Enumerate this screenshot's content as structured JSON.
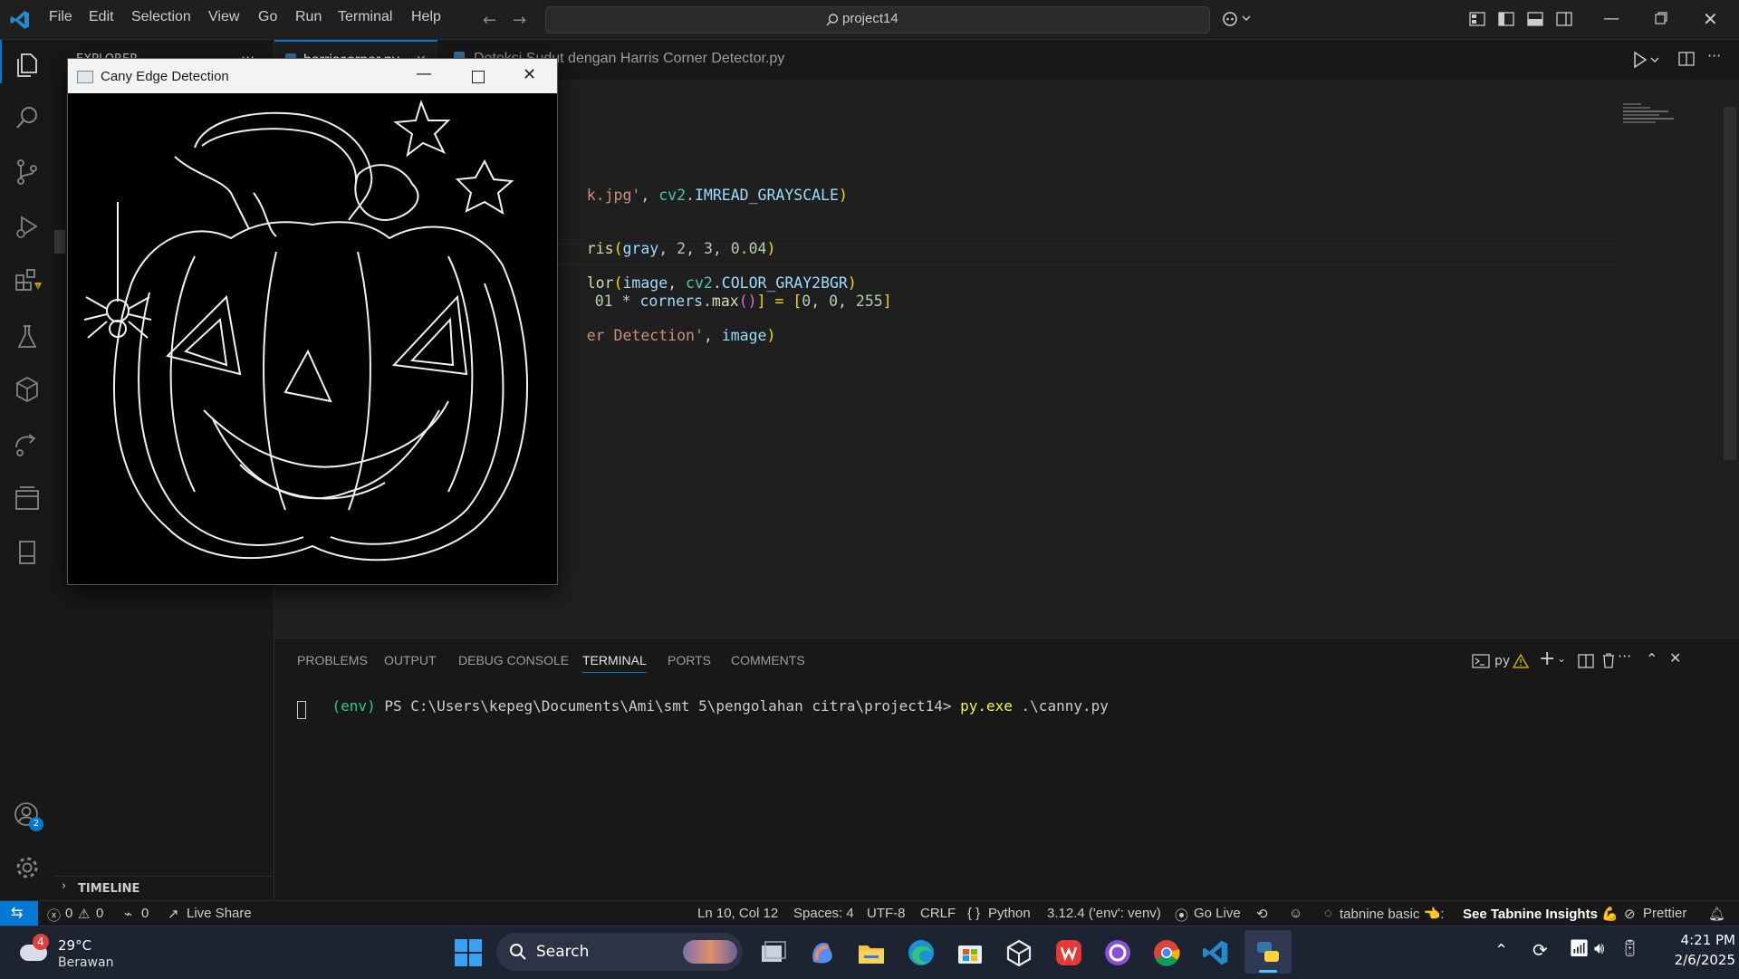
{
  "menu": [
    "File",
    "Edit",
    "Selection",
    "View",
    "Go",
    "Run",
    "Terminal",
    "Help"
  ],
  "search_label": "project14",
  "sidebar": {
    "explorer_title": "EXPLORER",
    "timeline_label": "TIMELINE"
  },
  "accounts_badge": "2",
  "tabs": [
    {
      "label": "harriscorner.py",
      "close": "✕"
    },
    {
      "label": "Deteksi Sudut dengan Harris Corner Detector.py"
    }
  ],
  "code": {
    "line1_a": "k.jpg'",
    "line1_b": ", ",
    "line1_c": "cv2",
    "line1_d": ".",
    "line1_e": "IMREAD_GRAYSCALE",
    "line1_f": ")",
    "line2": ")",
    "line3_a": "ris",
    "line3_b": "(",
    "line3_c": "gray",
    "line3_d": ", ",
    "line3_e": "2",
    "line3_f": ", ",
    "line3_g": "3",
    "line3_h": ", ",
    "line3_i": "0.04",
    "line3_j": ")",
    "line4_a": "lor",
    "line4_b": "(",
    "line4_c": "image",
    "line4_d": ", ",
    "line4_e": "cv2",
    "line4_f": ".",
    "line4_g": "COLOR_GRAY2BGR",
    "line4_h": ")",
    "line5_a": "01",
    "line5_b": " * ",
    "line5_c": "corners",
    "line5_d": ".",
    "line5_e": "max",
    "line5_f": "()",
    "line5_g": "] = ",
    "line5_h": "[",
    "line5_i": "0",
    "line5_j": ", ",
    "line5_k": "0",
    "line5_l": ", ",
    "line5_m": "255",
    "line5_n": "]",
    "line6_a": "er Detection'",
    "line6_b": ", ",
    "line6_c": "image",
    "line6_d": ")"
  },
  "panel_tabs": [
    "PROBLEMS",
    "OUTPUT",
    "DEBUG CONSOLE",
    "TERMINAL",
    "PORTS",
    "COMMENTS"
  ],
  "terminal": {
    "prompt_env": "(env)",
    "prompt_path": " PS C:\\Users\\kepeg\\Documents\\Ami\\smt 5\\pengolahan citra\\project14> ",
    "cmd": "py.exe",
    "cmd_arg": " .\\canny.py",
    "shell_label": "py"
  },
  "cv_window": {
    "title": "Cany Edge Detection"
  },
  "status": {
    "errors": "0",
    "warnings": "0",
    "ports": "0",
    "live_share": "Live Share",
    "position": "Ln 10, Col 12",
    "spaces": "Spaces: 4",
    "encoding": "UTF-8",
    "eol": "CRLF",
    "language": "Python",
    "interpreter": "3.12.4 ('env': venv)",
    "go_live": "Go Live",
    "tabnine": "tabnine basic 👈:",
    "tabnine_insights": "See Tabnine Insights 💪",
    "prettier": "Prettier"
  },
  "taskbar": {
    "weather_temp": "29°C",
    "weather_desc": "Berawan",
    "weather_badge": "4",
    "search": "Search",
    "time": "4:21 PM",
    "date": "2/6/2025"
  },
  "colors": {
    "accent": "#0078d4",
    "editor_bg": "#1f1f1f",
    "sidebar_bg": "#181818",
    "taskbar_bg": "#1c2331"
  }
}
